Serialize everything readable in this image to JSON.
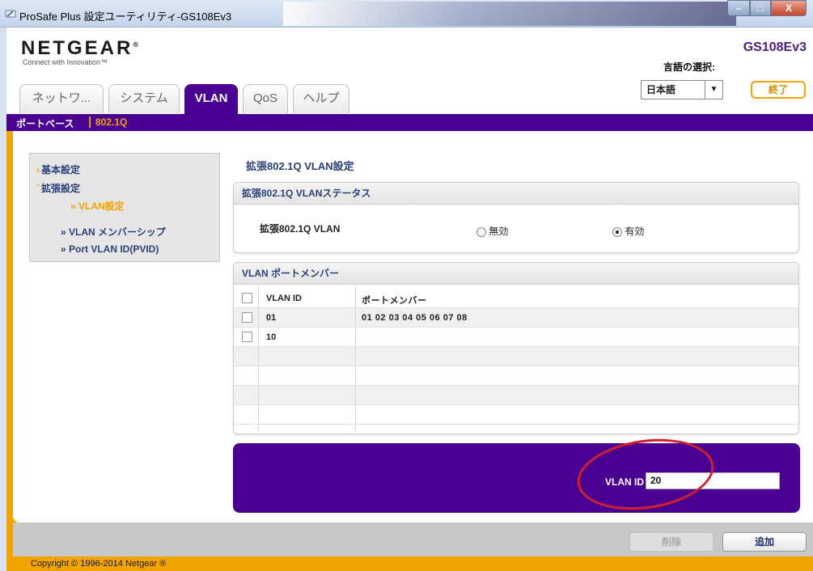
{
  "window": {
    "title": "ProSafe Plus 設定ユーティリティ-GS108Ev3",
    "minimize": "–",
    "maximize": "□",
    "close": "X"
  },
  "header": {
    "logo": "NETGEAR",
    "logo_mark": "®",
    "tagline": "Connect with Innovation™",
    "model": "GS108Ev3",
    "language_label": "言語の選択:",
    "language_value": "日本語",
    "exit_label": "終了"
  },
  "tabs": [
    {
      "label": "ネットワ...",
      "active": false
    },
    {
      "label": "システム",
      "active": false
    },
    {
      "label": "VLAN",
      "active": true
    },
    {
      "label": "QoS",
      "active": false
    },
    {
      "label": "ヘルプ",
      "active": false
    }
  ],
  "subnav": {
    "item1": "ポートベース",
    "separator": "|",
    "item2": "802.1Q"
  },
  "sidebar": {
    "items": [
      {
        "label": "基本設定"
      },
      {
        "label": "拡張設定"
      },
      {
        "label": "» VLAN設定"
      },
      {
        "label": "» VLAN メンバーシップ"
      },
      {
        "label": "» Port VLAN ID(PVID)"
      }
    ]
  },
  "main": {
    "page_title": "拡張802.1Q VLAN設定",
    "status_panel": {
      "header": "拡張802.1Q VLANステータス",
      "row_label": "拡張802.1Q VLAN",
      "option_disable": "無効",
      "option_enable": "有効",
      "selected": "有効"
    },
    "member_panel": {
      "header": "VLAN ポートメンバー",
      "columns": [
        "VLAN ID",
        "ポートメンバー"
      ],
      "rows": [
        {
          "vlan_id": "01",
          "members": "01 02 03 04 05 06 07 08"
        },
        {
          "vlan_id": "10",
          "members": ""
        }
      ]
    },
    "add_box": {
      "label": "VLAN ID",
      "value": "20"
    }
  },
  "footer": {
    "delete_label": "削除",
    "add_label": "追加",
    "copyright": "Copyright © 1996-2014 Netgear ®"
  },
  "colors": {
    "brand_purple": "#4a0090",
    "accent_orange": "#f2a400",
    "highlight_red": "#d0202a"
  }
}
